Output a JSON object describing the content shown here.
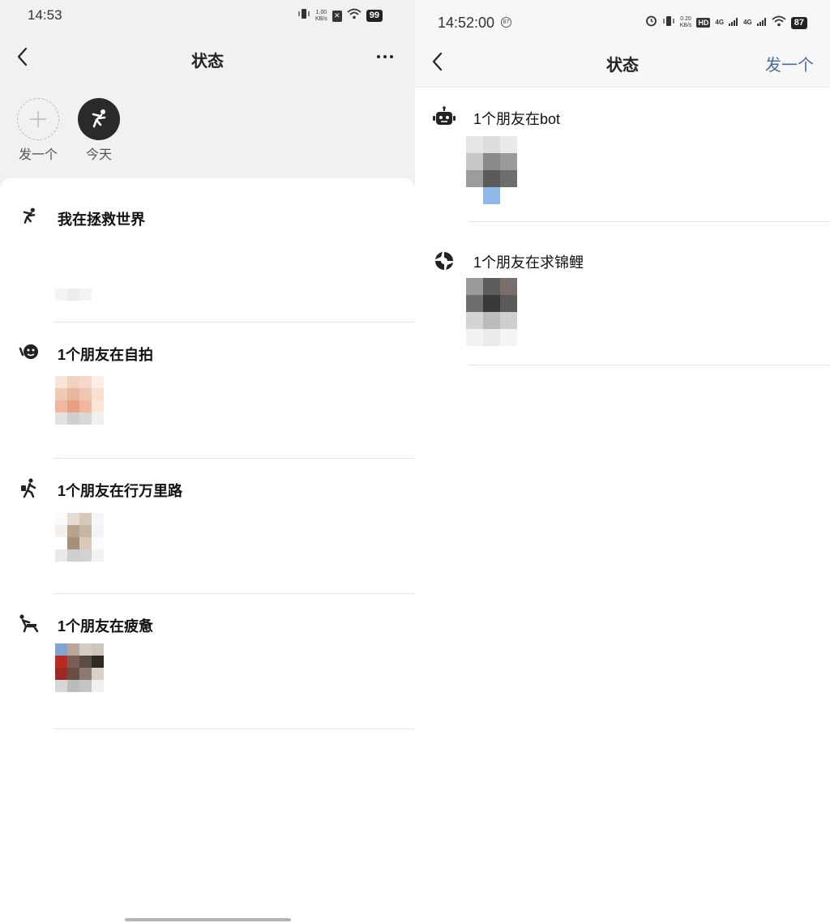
{
  "left": {
    "status_time": "14:53",
    "net_speed_value": "1.00",
    "net_speed_unit": "KB/s",
    "battery": "99",
    "nav_title": "状态",
    "stories": [
      {
        "label": "发一个"
      },
      {
        "label": "今天"
      }
    ],
    "items": [
      {
        "title": "我在拯救世界"
      },
      {
        "title": "1个朋友在自拍"
      },
      {
        "title": "1个朋友在行万里路"
      },
      {
        "title": "1个朋友在疲惫"
      }
    ]
  },
  "right": {
    "status_time": "14:52:00",
    "notif_badge": "87",
    "net_speed_value": "0.20",
    "net_speed_unit": "KB/s",
    "signal_1": "4G",
    "signal_2": "4G",
    "battery": "87",
    "nav_title": "状态",
    "post_label": "发一个",
    "items": [
      {
        "title": "1个朋友在bot"
      },
      {
        "title": "1个朋友在求锦鲤"
      }
    ]
  },
  "colors": {
    "accent_link": "#4a6a9a",
    "background_top": "#f1f1f1",
    "divider": "#e6e6e6"
  }
}
